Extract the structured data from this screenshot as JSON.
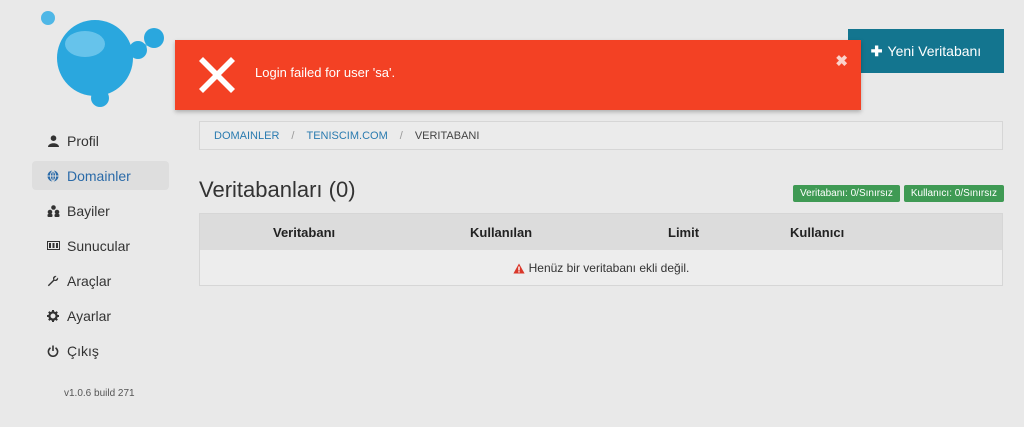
{
  "alert": {
    "message": "Login failed for user 'sa'.",
    "close_symbol": "✖"
  },
  "header": {
    "new_db_button": "Yeni Veritabanı"
  },
  "sidebar": {
    "items": [
      {
        "label": "Profil",
        "icon": "user-icon",
        "active": false
      },
      {
        "label": "Domainler",
        "icon": "globe-icon",
        "active": true
      },
      {
        "label": "Bayiler",
        "icon": "users-icon",
        "active": false
      },
      {
        "label": "Sunucular",
        "icon": "server-icon",
        "active": false
      },
      {
        "label": "Araçlar",
        "icon": "wrench-icon",
        "active": false
      },
      {
        "label": "Ayarlar",
        "icon": "gear-icon",
        "active": false
      },
      {
        "label": "Çıkış",
        "icon": "power-icon",
        "active": false
      }
    ],
    "version": "v1.0.6 build 271"
  },
  "breadcrumb": {
    "items": [
      "DOMAINLER",
      "TENISCIM.COM"
    ],
    "current": "VERITABANI"
  },
  "main": {
    "title": "Veritabanları (0)",
    "badges": [
      "Veritabanı: 0/Sınırsız",
      "Kullanıcı: 0/Sınırsız"
    ],
    "table": {
      "columns": [
        "Veritabanı",
        "Kullanılan",
        "Limit",
        "Kullanıcı"
      ],
      "empty_message": "Henüz bir veritabanı ekli değil."
    }
  },
  "colors": {
    "alert": "#f34124",
    "primary_button": "#13758f",
    "badge": "#3f9a54",
    "link": "#2a7bb0"
  }
}
